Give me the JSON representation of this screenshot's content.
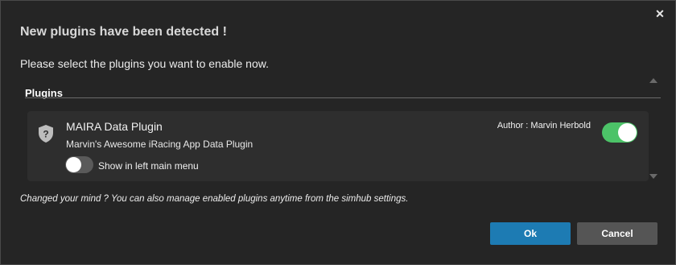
{
  "dialog": {
    "title": "New plugins have been detected !",
    "subtitle": "Please select the plugins you want to enable now.",
    "close_icon": "close-icon"
  },
  "plugins_section": {
    "label": "Plugins",
    "items": [
      {
        "icon": "shield-question-icon",
        "name": "MAIRA Data Plugin",
        "description": "Marvin's Awesome iRacing App Data Plugin",
        "author": "Author : Marvin Herbold",
        "enabled": true,
        "show_in_menu_label": "Show in left main menu",
        "show_in_menu": false
      }
    ]
  },
  "hint": "Changed your mind ? You can also manage enabled plugins anytime from the simhub settings.",
  "buttons": {
    "ok_label": "Ok",
    "cancel_label": "Cancel"
  },
  "colors": {
    "accent": "#1d7bb3",
    "toggle_on": "#4cc368",
    "toggle_off": "#5a5a5a"
  }
}
